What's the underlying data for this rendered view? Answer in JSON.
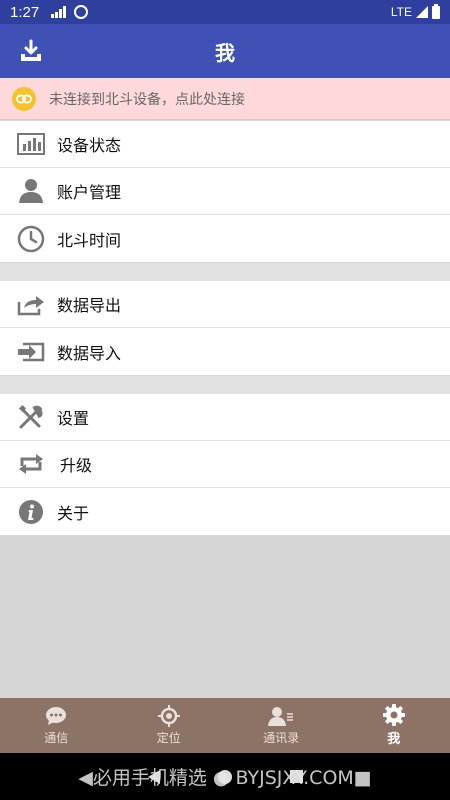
{
  "status_bar": {
    "time": "1:27",
    "network": "LTE"
  },
  "header": {
    "title": "我"
  },
  "banner": {
    "text": "未连接到北斗设备，点此处连接"
  },
  "groups": [
    {
      "items": [
        {
          "label": "设备状态",
          "icon": "bar-chart-icon"
        },
        {
          "label": "账户管理",
          "icon": "user-icon"
        },
        {
          "label": "北斗时间",
          "icon": "clock-icon"
        }
      ]
    },
    {
      "items": [
        {
          "label": "数据导出",
          "icon": "share-export-icon"
        },
        {
          "label": "数据导入",
          "icon": "import-icon"
        }
      ]
    },
    {
      "items": [
        {
          "label": "设置",
          "icon": "tools-icon"
        },
        {
          "label": "升级",
          "icon": "repeat-icon"
        },
        {
          "label": "关于",
          "icon": "info-icon"
        }
      ]
    }
  ],
  "bottom_nav": {
    "tabs": [
      {
        "label": "通信",
        "icon": "chat-icon"
      },
      {
        "label": "定位",
        "icon": "location-icon"
      },
      {
        "label": "通讯录",
        "icon": "contacts-icon"
      },
      {
        "label": "我",
        "icon": "gear-icon"
      }
    ],
    "active_index": 3
  },
  "watermark": "◀必用手机精选 ● BYJSJXY.COM■",
  "colors": {
    "primary": "#3f51b5",
    "banner_bg": "#ffd9d9",
    "nav_bg": "#8d7366",
    "link_icon": "#f2c230"
  }
}
